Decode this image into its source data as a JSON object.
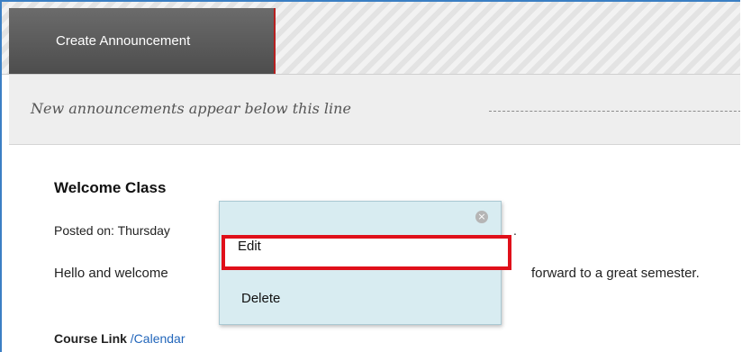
{
  "toolbar": {
    "create_label": "Create Announcement"
  },
  "notice": {
    "text": "New announcements appear below this line"
  },
  "announcement": {
    "title": "Welcome Class",
    "posted": "Posted on: Thursday",
    "posted_suffix": ".",
    "body_start": "Hello and welcome",
    "body_end": "forward to a great semester.",
    "course_link_label": "Course Link",
    "course_link_value": "/Calendar"
  },
  "context_menu": {
    "close_icon": "×",
    "items": [
      {
        "label": "Edit",
        "highlighted": true
      },
      {
        "label": "Delete",
        "highlighted": false
      }
    ]
  },
  "colors": {
    "accent": "#3b7fc4",
    "highlight_border": "#e0101a",
    "menu_bg": "#d8ecf1",
    "link": "#2266bb"
  }
}
